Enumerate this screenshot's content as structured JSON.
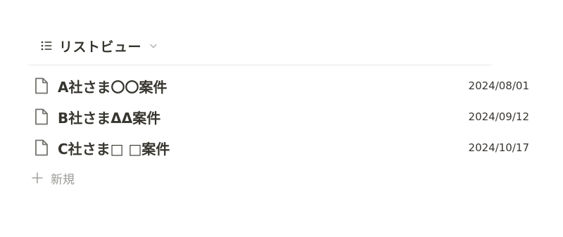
{
  "view": {
    "title": "リストビュー",
    "icon": "list-icon",
    "dropdown_icon": "chevron-down-icon"
  },
  "items": [
    {
      "title": "A社さま〇〇案件",
      "date": "2024/08/01",
      "icon": "page-icon"
    },
    {
      "title": "B社さまΔΔ案件",
      "date": "2024/09/12",
      "icon": "page-icon"
    },
    {
      "title": "C社さま□ □案件",
      "date": "2024/10/17",
      "icon": "page-icon"
    }
  ],
  "new_item": {
    "label": "新規",
    "icon": "plus-icon"
  },
  "colors": {
    "text": "#37352f",
    "muted": "#9b9a97",
    "divider": "#e9e9e7"
  }
}
